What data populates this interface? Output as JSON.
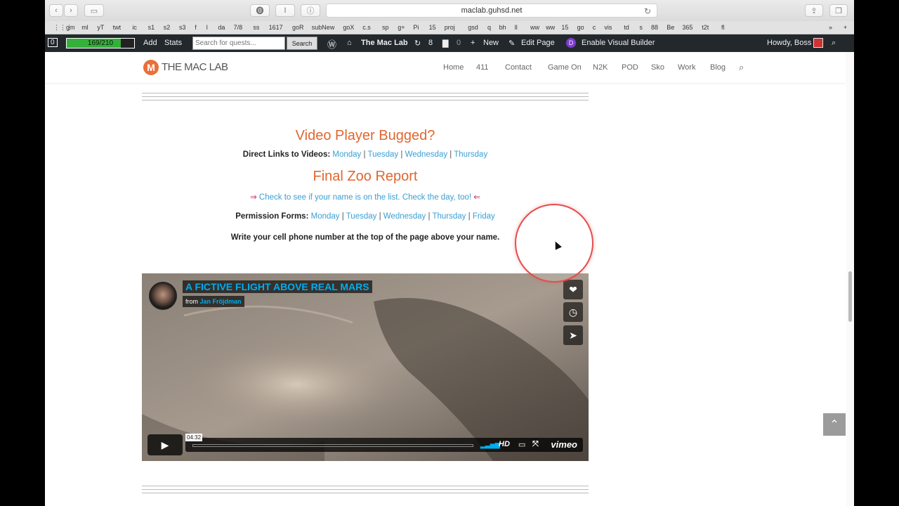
{
  "browser": {
    "url": "maclab.guhsd.net",
    "bookmarks": [
      "gm",
      "ml",
      "yT",
      "twt",
      "ic",
      "s1",
      "s2",
      "s3",
      "f",
      "l",
      "da",
      "7/8",
      "ss",
      "1617",
      "goR",
      "subNew",
      "goX",
      "c.s",
      "sp",
      "g+",
      "Pi",
      "15",
      "proj",
      "gsd",
      "q",
      "bh",
      "ll",
      "ww",
      "ww",
      "15",
      "go",
      "c",
      "vis",
      "td",
      "s",
      "88",
      "Be",
      "365",
      "t2t",
      "fl"
    ]
  },
  "adminbar": {
    "count_box": "0",
    "progress_text": "169/210",
    "progress_fraction": 0.805,
    "add": "Add",
    "stats": "Stats",
    "search_placeholder": "Search for quests...",
    "search_button": "Search",
    "site_name": "The Mac Lab",
    "updates": "8",
    "comments": "0",
    "new": "New",
    "edit_page": "Edit Page",
    "visual_builder": "Enable Visual Builder",
    "howdy": "Howdy, Boss"
  },
  "site": {
    "logo_letter": "M",
    "logo_text": "THE MAC LAB",
    "nav": [
      "Home",
      "411",
      "Contact",
      "Game On",
      "N2K",
      "POD",
      "Sko",
      "Work",
      "Blog"
    ]
  },
  "content": {
    "heading1": "Video Player Bugged?",
    "direct_label": "Direct Links to Videos:",
    "days4": [
      "Monday",
      "Tuesday",
      "Wednesday",
      "Thursday"
    ],
    "heading2": "Final Zoo Report",
    "check_arrow_left": "⇒",
    "check_text": "Check to see if your name is on the list. Check the day, too!",
    "check_arrow_right": "⇐",
    "permission_label": "Permission Forms:",
    "days5": [
      "Monday",
      "Tuesday",
      "Wednesday",
      "Thursday",
      "Friday"
    ],
    "phone_note": "Write your cell phone number at the top of the page above your name."
  },
  "video": {
    "title": "A FICTIVE FLIGHT ABOVE REAL MARS",
    "from_label": "from",
    "author": "Jan Fröjdman",
    "duration": "04:32",
    "hd": "HD",
    "brand": "vimeo"
  }
}
